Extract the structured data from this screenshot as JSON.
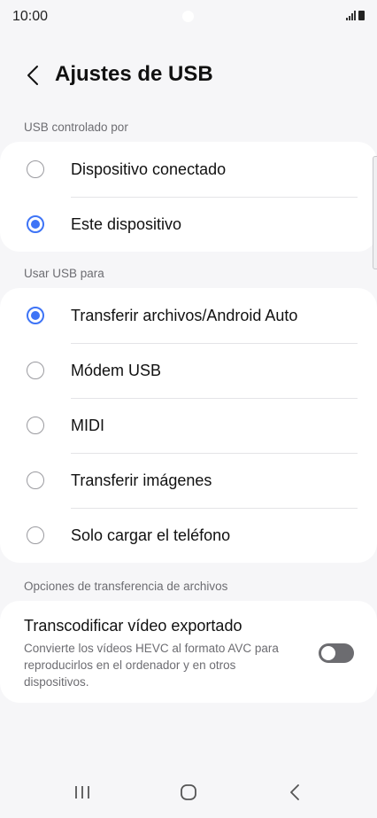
{
  "status_bar": {
    "time": "10:00"
  },
  "header": {
    "title": "Ajustes de USB"
  },
  "usb_controlled_by": {
    "label": "USB controlado por",
    "options": [
      {
        "label": "Dispositivo conectado",
        "selected": false
      },
      {
        "label": "Este dispositivo",
        "selected": true
      }
    ]
  },
  "use_usb_for": {
    "label": "Usar USB para",
    "options": [
      {
        "label": "Transferir archivos/Android Auto",
        "selected": true
      },
      {
        "label": "Módem USB",
        "selected": false
      },
      {
        "label": "MIDI",
        "selected": false
      },
      {
        "label": "Transferir imágenes",
        "selected": false
      },
      {
        "label": "Solo cargar el teléfono",
        "selected": false
      }
    ]
  },
  "file_transfer_options": {
    "label": "Opciones de transferencia de archivos",
    "transcode": {
      "title": "Transcodificar vídeo exportado",
      "description": "Convierte los vídeos HEVC al formato AVC para reproducirlos en el ordenador y en otros dispositivos.",
      "enabled": false
    }
  },
  "colors": {
    "accent": "#3e74f6",
    "background": "#f6f6f8",
    "toggle_off": "#6c6c70"
  }
}
